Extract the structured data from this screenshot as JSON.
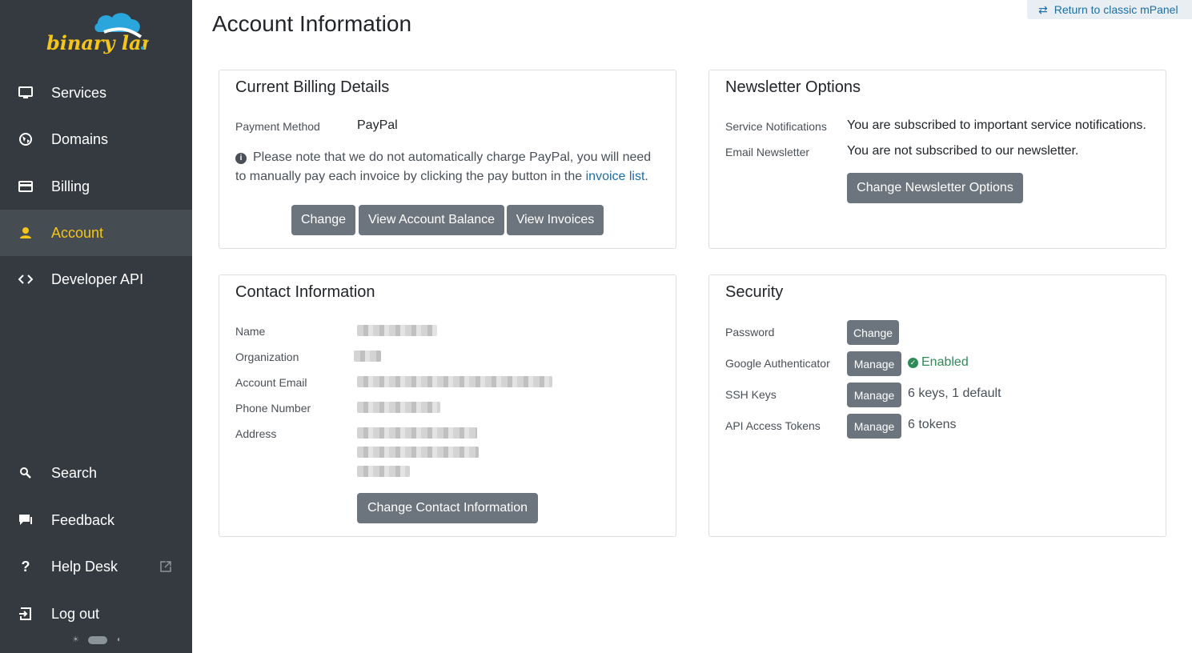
{
  "brand": {
    "logo_text": "binary lane"
  },
  "sidebar": {
    "items": [
      {
        "label": "Services",
        "icon": "monitor-icon"
      },
      {
        "label": "Domains",
        "icon": "globe-icon"
      },
      {
        "label": "Billing",
        "icon": "credit-card-icon"
      },
      {
        "label": "Account",
        "icon": "user-icon"
      },
      {
        "label": "Developer API",
        "icon": "code-icon"
      }
    ],
    "bottom_items": [
      {
        "label": "Search",
        "icon": "search-icon"
      },
      {
        "label": "Feedback",
        "icon": "feedback-icon"
      },
      {
        "label": "Help Desk",
        "icon": "question-icon"
      },
      {
        "label": "Log out",
        "icon": "logout-icon"
      }
    ]
  },
  "top_link": {
    "label": "Return to classic mPanel"
  },
  "page": {
    "title": "Account Information"
  },
  "billing": {
    "title": "Current Billing Details",
    "payment_method_label": "Payment Method",
    "payment_method_value": "PayPal",
    "note_text": "Please note that we do not automatically charge PayPal, you will need to manually pay each invoice by clicking the pay button in the",
    "note_link": "invoice list",
    "note_end": ".",
    "buttons": {
      "change": "Change",
      "balance": "View Account Balance",
      "invoices": "View Invoices"
    }
  },
  "newsletter": {
    "title": "Newsletter Options",
    "service_label": "Service Notifications",
    "service_value": "You are subscribed to important service notifications.",
    "email_label": "Email Newsletter",
    "email_value": "You are not subscribed to our newsletter.",
    "button": "Change Newsletter Options"
  },
  "contact": {
    "title": "Contact Information",
    "name_label": "Name",
    "org_label": "Organization",
    "email_label": "Account Email",
    "phone_label": "Phone Number",
    "address_label": "Address",
    "button": "Change Contact Information"
  },
  "security": {
    "title": "Security",
    "password_label": "Password",
    "password_button": "Change",
    "ga_label": "Google Authenticator",
    "ga_button": "Manage",
    "ga_status": "Enabled",
    "ssh_label": "SSH Keys",
    "ssh_button": "Manage",
    "ssh_status": "6 keys, 1 default",
    "api_label": "API Access Tokens",
    "api_button": "Manage",
    "api_status": "6 tokens"
  },
  "colors": {
    "sidebar_bg": "#343a40",
    "accent": "#f5c518",
    "button": "#6c757d",
    "link": "#1a6fa6",
    "success": "#2e8b57"
  }
}
